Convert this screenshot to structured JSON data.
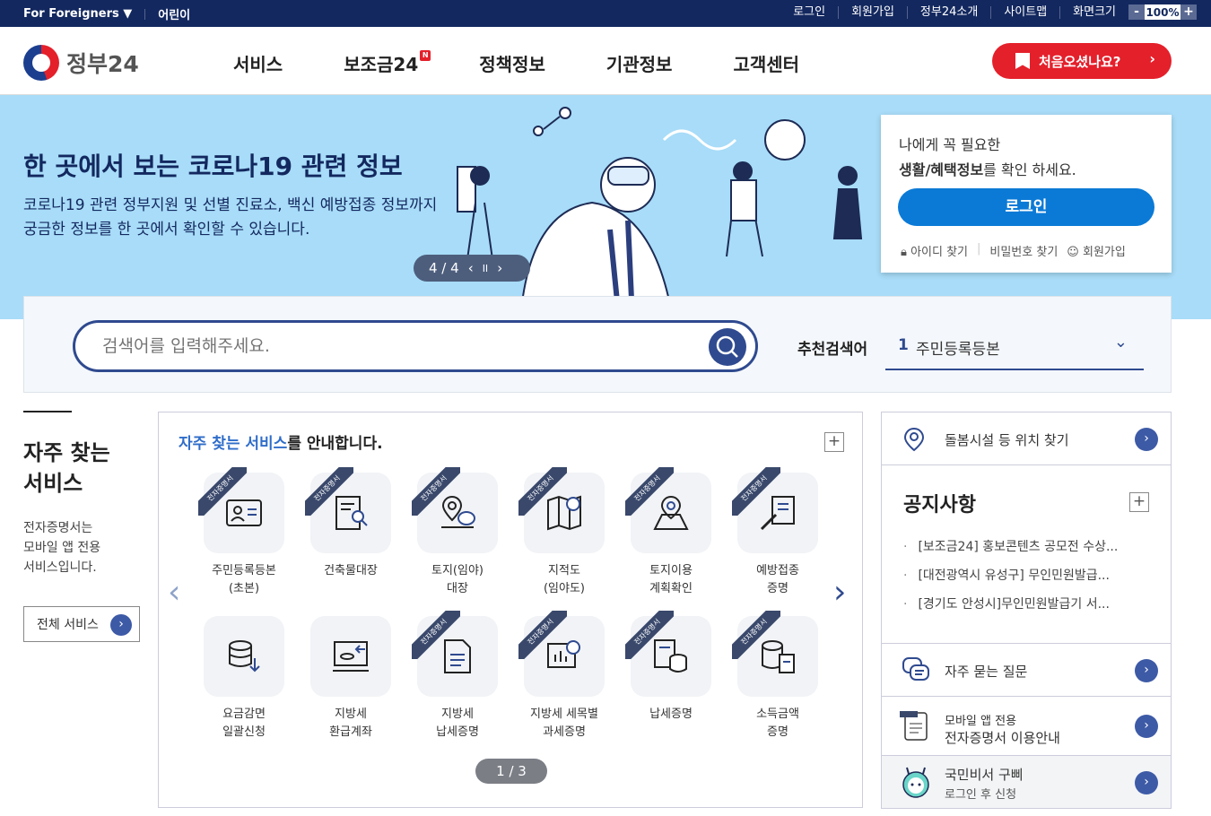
{
  "topbar": {
    "foreigners": "For Foreigners ▼",
    "kids": "어린이",
    "login": "로그인",
    "signup": "회원가입",
    "about": "정부24소개",
    "sitemap": "사이트맵",
    "screen": "화면크기",
    "zoom_minus": "-",
    "zoom_value": "100%",
    "zoom_plus": "+"
  },
  "header": {
    "logo": "정부24",
    "nav": [
      "서비스",
      "보조금24",
      "정책정보",
      "기관정보",
      "고객센터"
    ],
    "nav_badge": "N",
    "first_visit": "처음오셨나요?",
    "first_arrow": "›"
  },
  "hero": {
    "title": "한 곳에서 보는 코로나19 관련 정보",
    "desc1": "코로나19 관련 정부지원 및 선별 진료소, 백신 예방접종 정보까지",
    "desc2": "궁금한 정보를 한 곳에서 확인할 수 있습니다.",
    "pager": "4 / 4",
    "prev": "‹",
    "pause": "II",
    "next": "›"
  },
  "login": {
    "line1": "나에게 꼭 필요한",
    "line2_bold": "생활/혜택정보",
    "line2_rest": "를 확인 하세요.",
    "button": "로그인",
    "find_id": "아이디 찾기",
    "find_pw": "비밀번호 찾기",
    "join": "회원가입"
  },
  "search": {
    "placeholder": "검색어를 입력해주세요.",
    "rec_label": "추천검색어",
    "rec_num": "1",
    "rec_value": "주민등록등본",
    "chev": "⌄"
  },
  "frequent": {
    "title1": "자주 찾는",
    "title2": "서비스",
    "desc1": "전자증명서는",
    "desc2": "모바일 앱 전용",
    "desc3": "서비스입니다.",
    "all": "전체 서비스",
    "go": "›"
  },
  "services": {
    "heading_hl": "자주 찾는 서비스",
    "heading_rest": "를 안내합니다.",
    "plus": "+",
    "ribbon": "전자증명서",
    "row1": [
      {
        "l1": "주민등록등본",
        "l2": "(초본)",
        "icon": "id-card-icon",
        "rib": true
      },
      {
        "l1": "건축물대장",
        "l2": "",
        "icon": "document-search-icon",
        "rib": true
      },
      {
        "l1": "토지(임야)",
        "l2": "대장",
        "icon": "location-chat-icon",
        "rib": true
      },
      {
        "l1": "지적도",
        "l2": "(임야도)",
        "icon": "map-search-icon",
        "rib": true
      },
      {
        "l1": "토지이용",
        "l2": "계획확인",
        "icon": "map-pin-icon",
        "rib": true
      },
      {
        "l1": "예방접종",
        "l2": "증명",
        "icon": "syringe-doc-icon",
        "rib": true
      }
    ],
    "row2": [
      {
        "l1": "요금감면",
        "l2": "일괄신청",
        "icon": "coins-down-icon",
        "rib": false
      },
      {
        "l1": "지방세",
        "l2": "환급계좌",
        "icon": "monitor-coins-icon",
        "rib": false
      },
      {
        "l1": "지방세",
        "l2": "납세증명",
        "icon": "document-icon",
        "rib": true
      },
      {
        "l1": "지방세 세목별",
        "l2": "과세증명",
        "icon": "chart-board-icon",
        "rib": true
      },
      {
        "l1": "납세증명",
        "l2": "",
        "icon": "doc-coins-icon",
        "rib": true
      },
      {
        "l1": "소득금액",
        "l2": "증명",
        "icon": "coins-doc-icon",
        "rib": true
      }
    ],
    "prev": "‹",
    "next": "›",
    "page": "1 / 3"
  },
  "right": {
    "facility": "돌봄시설 등 위치 찾기",
    "notice_title": "공지사항",
    "plus": "+",
    "notices": [
      "[보조금24] 홍보콘텐츠 공모전 수상...",
      "[대전광역시 유성구] 무인민원발급...",
      "[경기도 안성시]무인민원발급기 서..."
    ],
    "faq": "자주 묻는 질문",
    "mobile1": "모바일 앱 전용",
    "mobile2": "전자증명서 이용안내",
    "gubbi1": "국민비서 구삐",
    "gubbi2": "로그인 후 신청",
    "go": "›"
  }
}
